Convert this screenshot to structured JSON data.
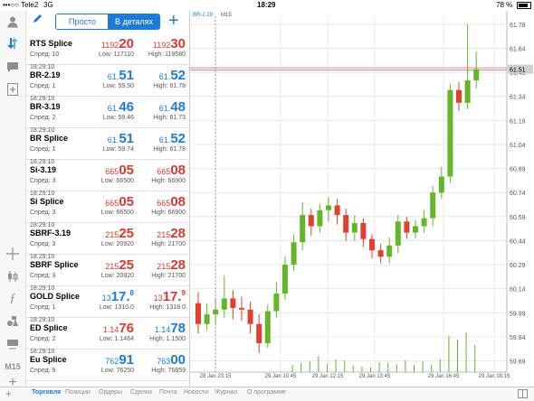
{
  "status_bar": {
    "carrier": "•••○○ Tele2",
    "network": "3G",
    "time": "18:29",
    "battery": "78 %"
  },
  "quotes": {
    "tabs": [
      "Просто",
      "В деталях"
    ],
    "active_tab": 1,
    "add_label": "+",
    "rows": [
      {
        "time": "",
        "symbol": "RTS Splice",
        "sub": "Спред: 10",
        "bid_pre": "1192",
        "bid_big": "20",
        "bid_sup": "",
        "ask_pre": "1192",
        "ask_big": "30",
        "ask_sup": "",
        "low": "Low: 117110",
        "high": "High: 119580",
        "color": "red"
      },
      {
        "time": "18:29:10",
        "symbol": "BR-2.19",
        "sub": "Спред: 1",
        "bid_pre": "61.",
        "bid_big": "51",
        "bid_sup": "",
        "ask_pre": "61.",
        "ask_big": "52",
        "ask_sup": "",
        "low": "Low: 59.50",
        "high": "High: 61.78",
        "color": "blue"
      },
      {
        "time": "18:29:10",
        "symbol": "BR-3.19",
        "sub": "Спред: 2",
        "bid_pre": "61.",
        "bid_big": "46",
        "bid_sup": "",
        "ask_pre": "61.",
        "ask_big": "48",
        "ask_sup": "",
        "low": "Low: 59.46",
        "high": "High: 61.73",
        "color": "blue"
      },
      {
        "time": "18:29:10",
        "symbol": "BR Splice",
        "sub": "Спред: 1",
        "bid_pre": "61.",
        "bid_big": "51",
        "bid_sup": "",
        "ask_pre": "61.",
        "ask_big": "52",
        "ask_sup": "",
        "low": "Low: 59.74",
        "high": "High: 61.78",
        "color": "blue"
      },
      {
        "time": "18:29:10",
        "symbol": "Si-3.19",
        "sub": "Спред: 3",
        "bid_pre": "665",
        "bid_big": "05",
        "bid_sup": "",
        "ask_pre": "665",
        "ask_big": "08",
        "ask_sup": "",
        "low": "Low: 66500",
        "high": "High: 66900",
        "color": "red"
      },
      {
        "time": "18:29:10",
        "symbol": "Si Splice",
        "sub": "Спред: 3",
        "bid_pre": "665",
        "bid_big": "05",
        "bid_sup": "",
        "ask_pre": "665",
        "ask_big": "08",
        "ask_sup": "",
        "low": "Low: 66500",
        "high": "High: 66900",
        "color": "red"
      },
      {
        "time": "18:29:10",
        "symbol": "SBRF-3.19",
        "sub": "Спред: 3",
        "bid_pre": "215",
        "bid_big": "25",
        "bid_sup": "",
        "ask_pre": "215",
        "ask_big": "28",
        "ask_sup": "",
        "low": "Low: 20920",
        "high": "High: 21700",
        "color": "red"
      },
      {
        "time": "18:29:10",
        "symbol": "SBRF Splice",
        "sub": "Спред: 3",
        "bid_pre": "215",
        "bid_big": "25",
        "bid_sup": "",
        "ask_pre": "215",
        "ask_big": "28",
        "ask_sup": "",
        "low": "Low: 20920",
        "high": "High: 21700",
        "color": "red"
      },
      {
        "time": "18:29:10",
        "symbol": "GOLD Splice",
        "sub": "Спред: 1",
        "bid_pre": "13",
        "bid_big": "17.",
        "bid_sup": "8",
        "ask_pre": "13",
        "ask_big": "17.",
        "ask_sup": "9",
        "low": "Low: 1310.0",
        "high": "High: 1318.0",
        "color_bid": "blue",
        "color_ask": "red",
        "color": "mixed"
      },
      {
        "time": "18:29:10",
        "symbol": "ED Splice",
        "sub": "Спред: 2",
        "bid_pre": "1.14",
        "bid_big": "76",
        "bid_sup": "",
        "ask_pre": "1.14",
        "ask_big": "78",
        "ask_sup": "",
        "low": "Low: 1.1464",
        "high": "High: 1.1500",
        "color_bid": "red",
        "color_ask": "blue",
        "color": "mixed"
      },
      {
        "time": "18:29:10",
        "symbol": "Eu Splice",
        "sub": "Спред: 9",
        "bid_pre": "762",
        "bid_big": "91",
        "bid_sup": "",
        "ask_pre": "763",
        "ask_big": "00",
        "ask_sup": "",
        "low": "Low: 76250",
        "high": "High: 76859",
        "color": "blue"
      }
    ]
  },
  "toolbar_icons": [
    "user-icon",
    "trade-icon",
    "chat-icon",
    "add-window-icon",
    "crosshair-icon",
    "candles-icon",
    "indicator-icon",
    "objects-icon",
    "timeframe-icon",
    "plus-icon"
  ],
  "toolbar_timeframe": "M15",
  "chart": {
    "symbol_label": "BR-2.19",
    "timeframe_label": "M15",
    "price_ticks": [
      "61.79",
      "61.64",
      "61.49",
      "61.34",
      "61.19",
      "61.04",
      "60.89",
      "60.74",
      "60.59",
      "60.44",
      "60.29",
      "60.14",
      "59.99",
      "59.84",
      "59.69"
    ],
    "time_ticks": [
      "28 Jan 23:15",
      "29 Jan 10:45",
      "29 Jan 12:15",
      "29 Jan 13:45",
      "29 Jan 16:45",
      "29 Jan 18:15"
    ],
    "current_price": "61.51",
    "up_color": "#63b52a",
    "down_color": "#e0402f",
    "grid_color": "#e8e8e8"
  },
  "chart_data": {
    "type": "candlestick",
    "y_range": [
      59.62,
      61.84
    ],
    "candles": [
      {
        "o": 60.05,
        "c": 59.92,
        "h": 60.12,
        "l": 59.86
      },
      {
        "o": 59.92,
        "c": 59.98,
        "h": 60.05,
        "l": 59.88
      },
      {
        "o": 59.98,
        "c": 60.01,
        "h": 60.08,
        "l": 59.92
      },
      {
        "o": 60.01,
        "c": 60.08,
        "h": 60.22,
        "l": 59.96
      },
      {
        "o": 60.08,
        "c": 60.02,
        "h": 60.13,
        "l": 59.95
      },
      {
        "o": 60.02,
        "c": 60.01,
        "h": 60.09,
        "l": 59.94
      },
      {
        "o": 60.01,
        "c": 59.92,
        "h": 60.06,
        "l": 59.86
      },
      {
        "o": 59.92,
        "c": 59.8,
        "h": 59.98,
        "l": 59.74
      },
      {
        "o": 59.8,
        "c": 60.0,
        "h": 60.04,
        "l": 59.77
      },
      {
        "o": 60.0,
        "c": 60.11,
        "h": 60.18,
        "l": 59.96
      },
      {
        "o": 60.11,
        "c": 60.29,
        "h": 60.34,
        "l": 60.07
      },
      {
        "o": 60.29,
        "c": 60.43,
        "h": 60.48,
        "l": 60.25
      },
      {
        "o": 60.43,
        "c": 60.6,
        "h": 60.68,
        "l": 60.38
      },
      {
        "o": 60.6,
        "c": 60.53,
        "h": 60.64,
        "l": 60.47
      },
      {
        "o": 60.53,
        "c": 60.63,
        "h": 60.67,
        "l": 60.49
      },
      {
        "o": 60.63,
        "c": 60.66,
        "h": 60.71,
        "l": 60.56
      },
      {
        "o": 60.66,
        "c": 60.6,
        "h": 60.7,
        "l": 60.54
      },
      {
        "o": 60.6,
        "c": 60.49,
        "h": 60.64,
        "l": 60.44
      },
      {
        "o": 60.49,
        "c": 60.55,
        "h": 60.6,
        "l": 60.44
      },
      {
        "o": 60.55,
        "c": 60.45,
        "h": 60.58,
        "l": 60.4
      },
      {
        "o": 60.45,
        "c": 60.38,
        "h": 60.48,
        "l": 60.33
      },
      {
        "o": 60.38,
        "c": 60.34,
        "h": 60.42,
        "l": 60.3
      },
      {
        "o": 60.34,
        "c": 60.41,
        "h": 60.46,
        "l": 60.3
      },
      {
        "o": 60.41,
        "c": 60.56,
        "h": 60.6,
        "l": 60.36
      },
      {
        "o": 60.56,
        "c": 60.49,
        "h": 60.59,
        "l": 60.45
      },
      {
        "o": 60.49,
        "c": 60.53,
        "h": 60.57,
        "l": 60.45
      },
      {
        "o": 60.53,
        "c": 60.58,
        "h": 60.63,
        "l": 60.49
      },
      {
        "o": 60.58,
        "c": 60.74,
        "h": 60.78,
        "l": 60.53
      },
      {
        "o": 60.74,
        "c": 60.84,
        "h": 60.9,
        "l": 60.7
      },
      {
        "o": 60.84,
        "c": 61.38,
        "h": 61.42,
        "l": 60.8
      },
      {
        "o": 61.38,
        "c": 61.3,
        "h": 61.43,
        "l": 61.25
      },
      {
        "o": 61.3,
        "c": 61.44,
        "h": 61.79,
        "l": 61.26
      },
      {
        "o": 61.44,
        "c": 61.51,
        "h": 61.62,
        "l": 61.39
      }
    ],
    "volumes": [
      0,
      0,
      0,
      0,
      0,
      0,
      0,
      0,
      0,
      0,
      0,
      8,
      10,
      12,
      18,
      9,
      14,
      13,
      7,
      6,
      5,
      11,
      10,
      9,
      13,
      8,
      12,
      8,
      14,
      40,
      36,
      44,
      30
    ]
  },
  "tabbar": {
    "tabs": [
      "Торговля",
      "Позиции",
      "Ордеры",
      "Сделки",
      "Почта",
      "Новости",
      "Журнал",
      "О программе"
    ],
    "active": 0
  }
}
